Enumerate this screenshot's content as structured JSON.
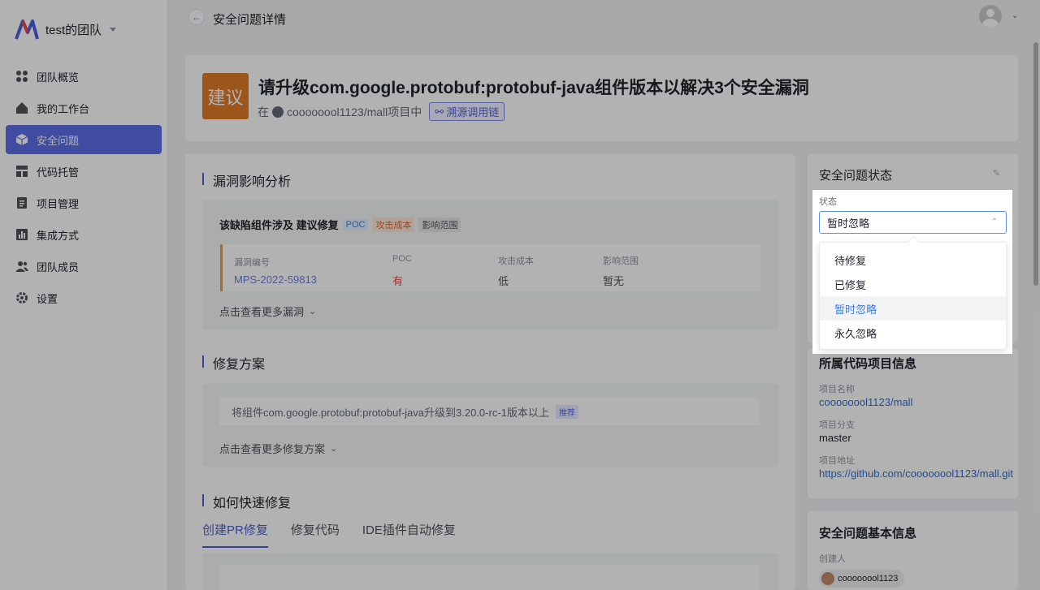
{
  "sidebar": {
    "team_name": "test的团队",
    "items": [
      {
        "label": "团队概览",
        "icon": "dashboard-icon"
      },
      {
        "label": "我的工作台",
        "icon": "home-icon"
      },
      {
        "label": "安全问题",
        "icon": "cube-icon",
        "active": true
      },
      {
        "label": "代码托管",
        "icon": "layout-icon"
      },
      {
        "label": "项目管理",
        "icon": "clipboard-icon"
      },
      {
        "label": "集成方式",
        "icon": "chart-icon"
      },
      {
        "label": "团队成员",
        "icon": "users-icon"
      },
      {
        "label": "设置",
        "icon": "gear-icon"
      }
    ]
  },
  "topbar": {
    "title": "安全问题详情"
  },
  "issue": {
    "badge": "建议",
    "title": "请升级com.google.protobuf:protobuf-java组件版本以解决3个安全漏洞",
    "sub_prefix": "在",
    "repo": "coooooool1123/mall项目中",
    "trace_button": "溯源调用链"
  },
  "impact": {
    "heading": "漏洞影响分析",
    "summary": "该缺陷组件涉及 建议修复",
    "tags": {
      "poc": "POC",
      "cost": "攻击成本",
      "range": "影响范围"
    },
    "columns": [
      "漏洞编号",
      "POC",
      "攻击成本",
      "影响范围"
    ],
    "row": {
      "id": "MPS-2022-59813",
      "poc": "有",
      "cost": "低",
      "range": "暂无"
    },
    "more": "点击查看更多漏洞"
  },
  "fix": {
    "heading": "修复方案",
    "plan": "将组件com.google.protobuf:protobuf-java升级到3.20.0-rc-1版本以上",
    "recommend": "推荐",
    "more": "点击查看更多修复方案"
  },
  "quickfix": {
    "heading": "如何快速修复",
    "tabs": [
      "创建PR修复",
      "修复代码",
      "IDE插件自动修复"
    ]
  },
  "status_card": {
    "heading": "安全问题状态",
    "label": "状态",
    "selected": "暂时忽略",
    "options": [
      "待修复",
      "已修复",
      "暂时忽略",
      "永久忽略"
    ]
  },
  "project_card": {
    "heading": "所属代码项目信息",
    "name_label": "项目名称",
    "name": "coooooool1123/mall",
    "branch_label": "项目分支",
    "branch": "master",
    "url_label": "项目地址",
    "url": "https://github.com/coooooool1123/mall.git"
  },
  "basic_card": {
    "heading": "安全问题基本信息",
    "creator_label": "创建人",
    "creator": "coooooool1123"
  },
  "colors": {
    "accent": "#5b6ee8",
    "badge": "#e07a28",
    "link": "#2f6fd6"
  }
}
